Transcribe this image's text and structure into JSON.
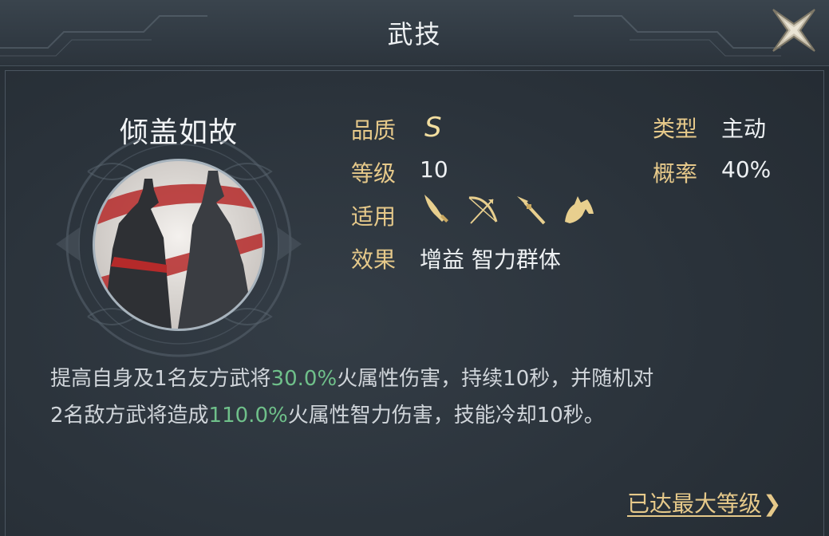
{
  "header": {
    "title": "武技"
  },
  "skill": {
    "name": "倾盖如故",
    "quality_label": "品质",
    "quality_value": "S",
    "level_label": "等级",
    "level_value": "10",
    "applies_label": "适用",
    "effect_label": "效果",
    "effect_value": "增益 智力群体",
    "type_label": "类型",
    "type_value": "主动",
    "rate_label": "概率",
    "rate_value": "40%",
    "weapons": [
      "saber-icon",
      "bow-icon",
      "spear-icon",
      "horse-icon"
    ]
  },
  "description": {
    "line1_a": "提高自身及1名友方武将",
    "line1_pct": "30.0%",
    "line1_b": "火属性伤害，持续10秒，并随机对",
    "line2_a": "2名敌方武将造成",
    "line2_pct": "110.0%",
    "line2_b": "火属性智力伤害，技能冷却10秒。"
  },
  "footer": {
    "max_level": "已达最大等级",
    "chevron": "❯"
  },
  "colors": {
    "label_gold": "#e6c98a",
    "highlight_green": "#6fc08a",
    "background": "#2b333b"
  }
}
